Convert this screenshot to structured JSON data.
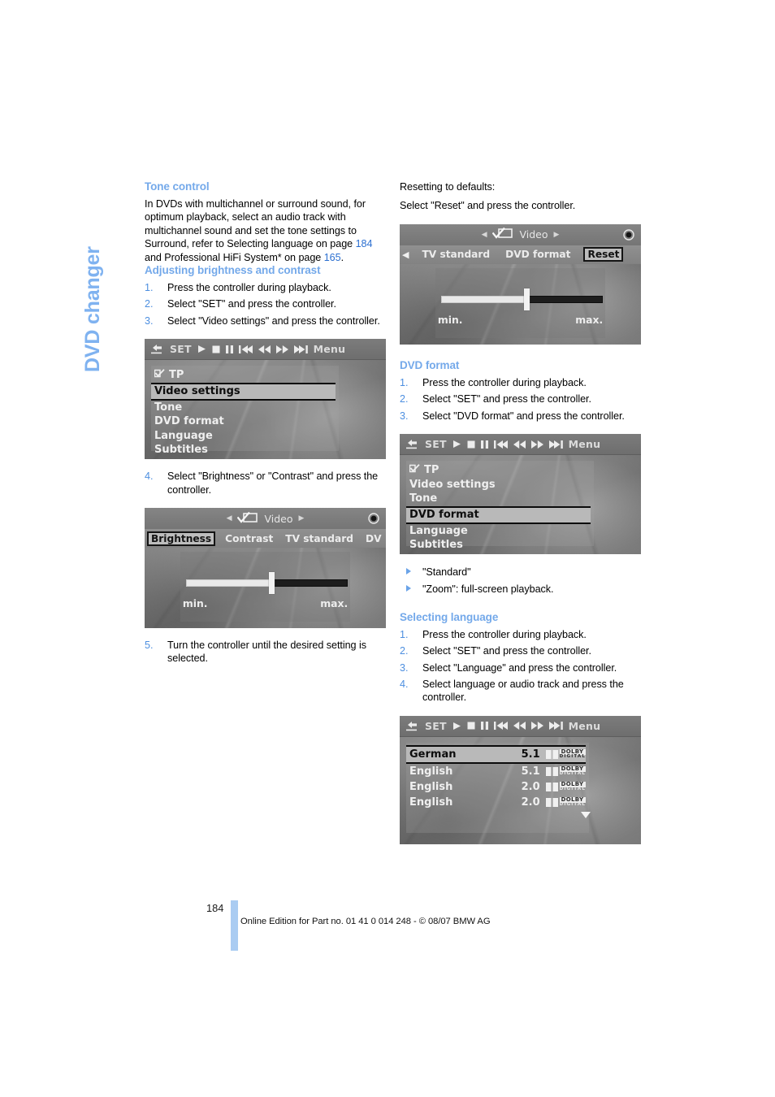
{
  "chapter": {
    "title": "DVD changer",
    "accent": "#7fb2f0"
  },
  "left_column": {
    "tone_control": {
      "heading": "Tone control",
      "paragraph_parts": [
        {
          "text": "In DVDs with multichannel or surround sound, for optimum playback, select an audio track with multichannel sound and set the tone settings to Surround, refer to Selecting language on page "
        },
        {
          "text": "184",
          "style": "page-ref"
        },
        {
          "text": " and Professional HiFi System* on page "
        },
        {
          "text": "165",
          "style": "page-ref"
        },
        {
          "text": "."
        }
      ],
      "paragraph_plain": "In DVDs with multichannel or surround sound, for optimum playback, select an audio track with multichannel sound and set the tone settings to Surround, refer to Selecting language on page 184 and Professional HiFi System* on page 165."
    },
    "brightness_contrast": {
      "heading": "Adjusting brightness and contrast",
      "steps": [
        {
          "num": "1.",
          "text": "Press the controller during playback."
        },
        {
          "num": "2.",
          "text": "Select \"SET\" and press the controller."
        },
        {
          "num": "3.",
          "text": "Select \"Video settings\" and press the controller."
        },
        {
          "num": "4.",
          "text": "Select \"Brightness\" or \"Contrast\" and press the controller."
        },
        {
          "num": "5.",
          "text": "Turn the controller until the desired setting is selected."
        }
      ]
    }
  },
  "right_column": {
    "reset": {
      "line1": "Resetting to defaults:",
      "line2": "Select \"Reset\" and press the controller."
    },
    "dvd_format": {
      "heading": "DVD format",
      "steps": [
        {
          "num": "1.",
          "text": "Press the controller during playback."
        },
        {
          "num": "2.",
          "text": "Select \"SET\" and press the controller."
        },
        {
          "num": "3.",
          "text": "Select \"DVD format\" and press the controller."
        }
      ],
      "options": [
        "\"Standard\"",
        "\"Zoom\": full-screen playback."
      ]
    },
    "selecting_language": {
      "heading": "Selecting language",
      "steps": [
        {
          "num": "1.",
          "text": "Press the controller during playback."
        },
        {
          "num": "2.",
          "text": "Select \"SET\" and press the controller."
        },
        {
          "num": "3.",
          "text": "Select \"Language\" and press the controller."
        },
        {
          "num": "4.",
          "text": "Select language or audio track and press the controller."
        }
      ]
    }
  },
  "screenshots": {
    "toolbar": {
      "set_label": "SET",
      "menu_label": "Menu",
      "icons": [
        "back-arrow-icon",
        "play-icon",
        "stop-icon",
        "pause-icon",
        "previous-track-icon",
        "rewind-icon",
        "fast-forward-icon",
        "next-track-icon"
      ]
    },
    "video_settings_menu": {
      "tp_label": "TP",
      "items": [
        {
          "label": "Video settings",
          "selected": true
        },
        {
          "label": "Tone",
          "selected": false
        },
        {
          "label": "DVD format",
          "selected": false
        },
        {
          "label": "Language",
          "selected": false
        },
        {
          "label": "Subtitles",
          "selected": false
        }
      ]
    },
    "dvd_format_menu": {
      "tp_label": "TP",
      "items": [
        {
          "label": "Video settings",
          "selected": false
        },
        {
          "label": "Tone",
          "selected": false
        },
        {
          "label": "DVD format",
          "selected": true
        },
        {
          "label": "Language",
          "selected": false
        },
        {
          "label": "Subtitles",
          "selected": false
        }
      ]
    },
    "brightness_screen": {
      "title": "Video",
      "tabs": [
        {
          "label": "Brightness",
          "selected": true
        },
        {
          "label": "Contrast",
          "selected": false
        },
        {
          "label": "TV standard",
          "selected": false
        },
        {
          "label": "DV",
          "selected": false
        }
      ],
      "slider_min_label": "min.",
      "slider_max_label": "max.",
      "slider_position_percent": 52
    },
    "reset_screen": {
      "title": "Video",
      "tabs": [
        {
          "label": "TV standard",
          "selected": false
        },
        {
          "label": "DVD format",
          "selected": false
        },
        {
          "label": "Reset",
          "selected": true
        }
      ],
      "slider_min_label": "min.",
      "slider_max_label": "max.",
      "slider_position_percent": 52
    },
    "language_screen": {
      "rows": [
        {
          "language": "German",
          "channels": "5.1",
          "format": "DOLBY DIGITAL",
          "selected": true
        },
        {
          "language": "English",
          "channels": "5.1",
          "format": "DOLBY DIGITAL",
          "selected": false
        },
        {
          "language": "English",
          "channels": "2.0",
          "format": "DOLBY DIGITAL",
          "selected": false
        },
        {
          "language": "English",
          "channels": "2.0",
          "format": "DOLBY DIGITAL",
          "selected": false
        }
      ],
      "dolby_line1": "DOLBY",
      "dolby_line2": "DIGITAL"
    }
  },
  "footer": {
    "page_number": "184",
    "note": "Online Edition for Part no. 01 41 0 014 248 - © 08/07 BMW AG"
  }
}
